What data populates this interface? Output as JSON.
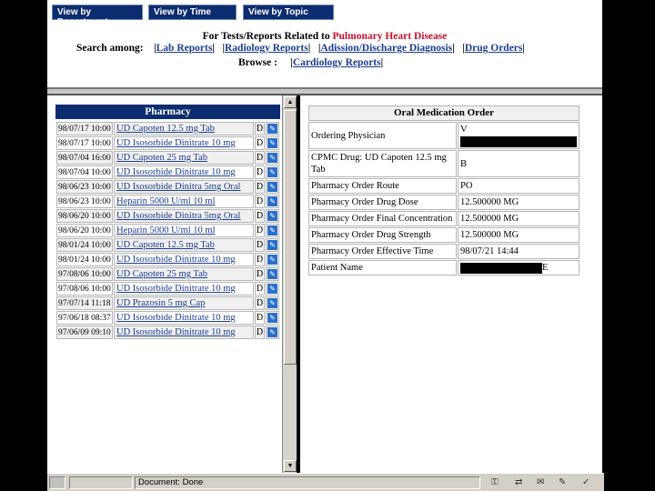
{
  "tabs": {
    "department": "View by Department",
    "time": "View by Time",
    "topic": "View by Topic"
  },
  "heading": {
    "prefix": "For Tests/Reports Related to",
    "topic": "Pulmonary Heart Disease"
  },
  "search": {
    "label": "Search among",
    "links": [
      "Lab Reports",
      "Radiology Reports",
      "Adission/Discharge Diagnosis",
      "Drug Orders"
    ]
  },
  "browse": {
    "label": "Browse",
    "link": "Cardiology Reports"
  },
  "pharmacy": {
    "title": "Pharmacy",
    "rows": [
      {
        "date": "98/07/17 10:00",
        "drug": "UD Capoten 12.5 mg Tab",
        "flag": "D"
      },
      {
        "date": "98/07/17 10:00",
        "drug": "UD Isosorbide Dinitrate 10 mg",
        "flag": "D"
      },
      {
        "date": "98/07/04 16:00",
        "drug": "UD Capoten 25 mg Tab",
        "flag": "D"
      },
      {
        "date": "98/07/04 10:00",
        "drug": "UD Isosorbide Dinitrate 10 mg",
        "flag": "D"
      },
      {
        "date": "98/06/23 10:00",
        "drug": "UD Isosorbide Dinitra 5mg Oral",
        "flag": "D"
      },
      {
        "date": "98/06/23 10:00",
        "drug": "Heparin 5000 U/ml 10 ml",
        "flag": "D"
      },
      {
        "date": "98/06/20 10:00",
        "drug": "UD Isosorbide Dinitra 5mg Oral",
        "flag": "D"
      },
      {
        "date": "98/06/20 10:00",
        "drug": "Heparin 5000 U/ml 10 ml",
        "flag": "D"
      },
      {
        "date": "98/01/24 10:00",
        "drug": "UD Capoten 12.5 mg Tab",
        "flag": "D"
      },
      {
        "date": "98/01/24 10:00",
        "drug": "UD Isosorbide Dinitrate 10 mg",
        "flag": "D"
      },
      {
        "date": "97/08/06 10:00",
        "drug": "UD Capoten 25 mg Tab",
        "flag": "D"
      },
      {
        "date": "97/08/06 10:00",
        "drug": "UD Isosorbide Dinitrate 10 mg",
        "flag": "D"
      },
      {
        "date": "97/07/14 11:18",
        "drug": "UD Prazosin 5 mg Cap",
        "flag": "D"
      },
      {
        "date": "97/06/18 08:37",
        "drug": "UD Isosorbide Dinitrate 10 mg",
        "flag": "D"
      },
      {
        "date": "97/06/09 09:10",
        "drug": "UD Isosorbide Dinitrate 10 mg",
        "flag": "D"
      }
    ]
  },
  "order": {
    "title": "Oral Medication Order",
    "fields": [
      {
        "label": "Ordering Physician",
        "value": "V",
        "redacted": true
      },
      {
        "label": "CPMC Drug: UD Capoten 12.5 mg Tab",
        "value": "B",
        "redacted": false
      },
      {
        "label": "Pharmacy Order Route",
        "value": "PO",
        "redacted": false
      },
      {
        "label": "Pharmacy Order Drug Dose",
        "value": "12.500000 MG",
        "redacted": false
      },
      {
        "label": "Pharmacy Order Final Concentration",
        "value": "12.500000 MG",
        "redacted": false
      },
      {
        "label": "Pharmacy Order Drug Strength",
        "value": "12.500000 MG",
        "redacted": false
      },
      {
        "label": "Pharmacy Order Effective Time",
        "value": "98/07/21 14:44",
        "redacted": false
      },
      {
        "label": "Patient Name",
        "value": "E",
        "redacted": true
      }
    ]
  },
  "status": {
    "text": "Document: Done"
  },
  "colors": {
    "header_bg": "#0b2c6e",
    "link": "#1a3d8f",
    "topic": "#c8102e"
  }
}
